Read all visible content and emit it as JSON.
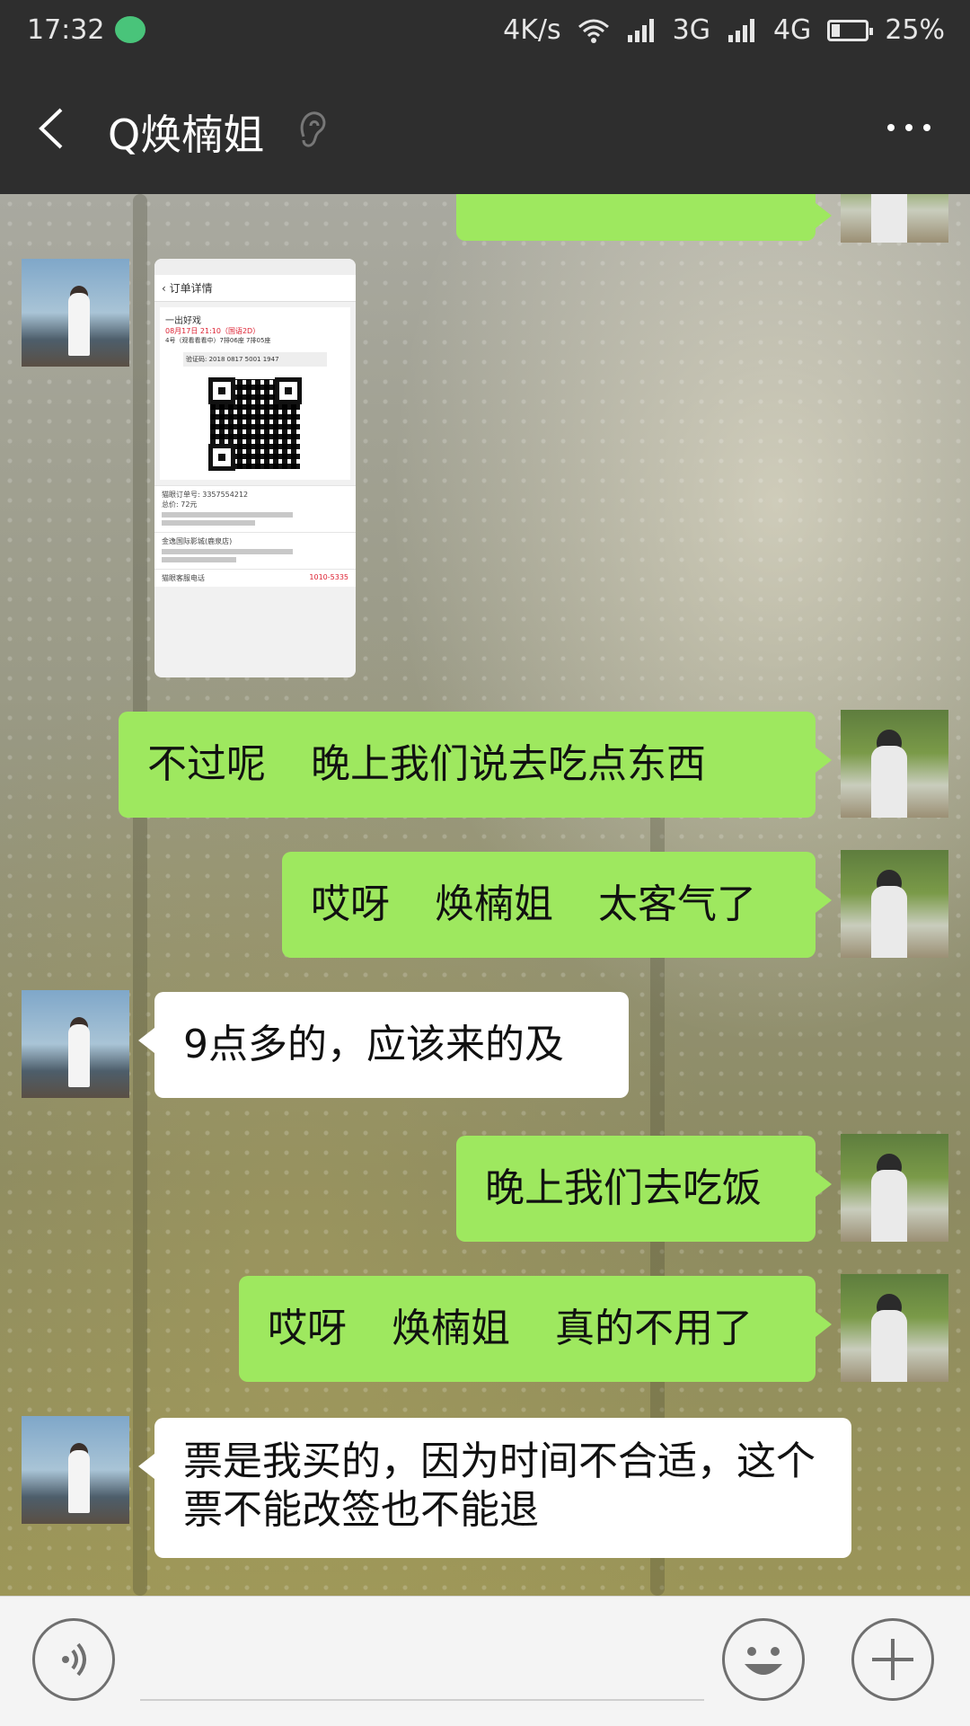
{
  "status_bar": {
    "time": "17:32",
    "network_speed": "4K/s",
    "network_3g": "3G",
    "network_4g": "4G",
    "battery_percent": "25%",
    "battery_level": 0.25,
    "icons": [
      "wechat-icon",
      "wifi-icon",
      "signal-icon",
      "battery-icon"
    ]
  },
  "header": {
    "title": "Q焕楠姐",
    "back_icon": "chevron-left-icon",
    "earpiece_icon": "ear-icon",
    "more_icon": "more-dots-icon"
  },
  "colors": {
    "bar_bg": "#2e2e2e",
    "my_bubble": "#9ee85f",
    "their_bubble": "#ffffff"
  },
  "shared_image": {
    "header_title": "订单详情",
    "movie": "一出好戏",
    "showtime": "08月17日 21:10（国语2D）",
    "seats": "4号（观看看看中）7排06座 7排05座",
    "verify_label": "验证码:",
    "verify_code": "2018 0817 5001 1947",
    "order_label": "猫眼订单号: 3357554212",
    "total_label": "总价: 72元",
    "cinema": "金逸国际影城(鹿泉店)",
    "service_label": "猫眼客服电话",
    "service_phone": "1010-5335"
  },
  "messages": [
    {
      "sender": "me",
      "parts": [
        "不过呢",
        "晚上我们说去吃点东西"
      ]
    },
    {
      "sender": "me",
      "parts": [
        "哎呀",
        "焕楠姐",
        "太客气了"
      ]
    },
    {
      "sender": "her",
      "parts": [
        "9点多的，应该来的及"
      ]
    },
    {
      "sender": "me",
      "parts": [
        "晚上我们去吃饭"
      ]
    },
    {
      "sender": "me",
      "parts": [
        "哎呀",
        "焕楠姐",
        "真的不用了"
      ]
    },
    {
      "sender": "her",
      "parts": [
        "票是我买的，因为时间不合适，这个票不能改签也不能退"
      ]
    }
  ],
  "input_bar": {
    "placeholder": "",
    "voice_icon": "voice-icon",
    "emoji_icon": "emoji-icon",
    "plus_icon": "plus-icon"
  }
}
